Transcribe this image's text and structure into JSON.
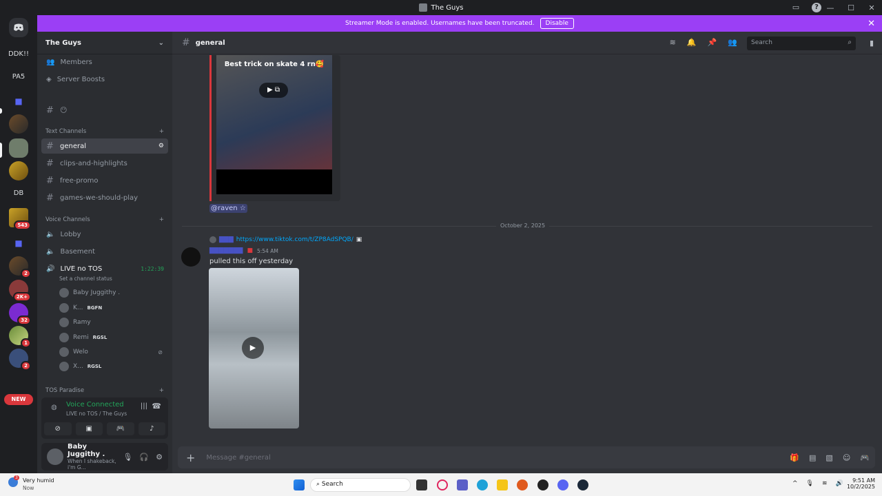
{
  "window": {
    "title": "The Guys"
  },
  "banner": {
    "text": "Streamer Mode is enabled. Usernames have been truncated.",
    "button": "Disable"
  },
  "guilds": {
    "ddk": "DDK!!",
    "pa5": "PA5",
    "db": "DB",
    "badge543": "543",
    "badge2a": "2",
    "badge2k": "2K+",
    "badge32": "32",
    "badge1": "1",
    "badge2b": "2",
    "new": "NEW"
  },
  "server": {
    "name": "The Guys",
    "members": "Members",
    "boosts": "Server Boosts"
  },
  "text_channels": {
    "label": "Text Channels",
    "items": [
      "general",
      "clips-and-highlights",
      "free-promo",
      "games-we-should-play"
    ]
  },
  "voice_channels": {
    "label": "Voice Channels",
    "lobby": "Lobby",
    "basement": "Basement",
    "live": "LIVE no TOS",
    "timer": "1:22:39",
    "status": "Set a channel status"
  },
  "voice_users": [
    {
      "name": "Baby Juggithy .",
      "tag": ""
    },
    {
      "name": "K...",
      "tag": "BGFN"
    },
    {
      "name": "Ramy",
      "tag": ""
    },
    {
      "name": "Remi",
      "tag": "RGSL"
    },
    {
      "name": "Welo",
      "tag": ""
    },
    {
      "name": "X...",
      "tag": "RGSL"
    }
  ],
  "tos_paradise": "TOS Paradise",
  "voice_connected": {
    "label": "Voice Connected",
    "channel": "LIVE no TOS / The Guys"
  },
  "user": {
    "name": "Baby Juggithy .",
    "status": "When I shakeback, i'm G..."
  },
  "channel": {
    "name": "general"
  },
  "search": {
    "placeholder": "Search"
  },
  "messages": {
    "video1_caption": "Best trick on skate 4 rn🥰",
    "mention": "@raven ☆",
    "date_divider": "October 2, 2025",
    "reply_link": "https://www.tiktok.com/t/ZP8AdSPQB/",
    "time": "5:54 AM",
    "text": "pulled this off yesterday"
  },
  "composer": {
    "placeholder": "Message #general"
  },
  "taskbar": {
    "weather": "Very humid",
    "weather_sub": "Now",
    "weather_badge": "3",
    "search": "Search",
    "time": "9:51 AM",
    "date": "10/2/2025"
  }
}
